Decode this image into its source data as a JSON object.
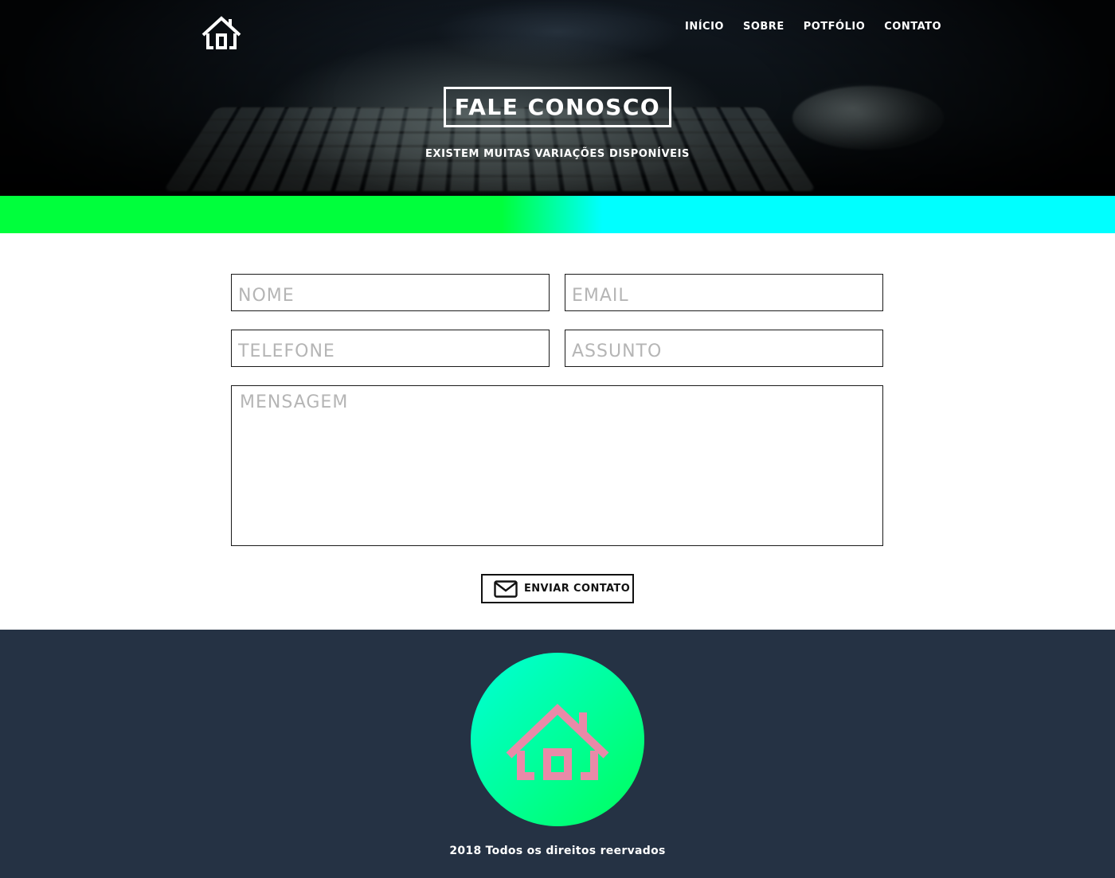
{
  "header": {
    "logo_icon": "house-icon",
    "nav": [
      {
        "label": "INÍCIO"
      },
      {
        "label": "SOBRE"
      },
      {
        "label": "POTFÓLIO"
      },
      {
        "label": "CONTATO"
      }
    ]
  },
  "hero": {
    "title": "FALE CONOSCO",
    "subtitle": "EXISTEM MUITAS VARIAÇÕES DISPONÍVEIS"
  },
  "form": {
    "nome_placeholder": "NOME",
    "email_placeholder": "EMAIL",
    "telefone_placeholder": "TELEFONE",
    "assunto_placeholder": "ASSUNTO",
    "mensagem_placeholder": "MENSAGEM",
    "submit_label": "ENVIAR CONTATO",
    "submit_icon": "envelope-icon"
  },
  "footer": {
    "logo_icon": "house-icon",
    "copyright": "2018 Todos os direitos reervados"
  },
  "colors": {
    "gradient_green": "#00ff3c",
    "gradient_cyan": "#00ffff",
    "footer_bg": "#253244",
    "footer_logo": "#e98aa8"
  }
}
